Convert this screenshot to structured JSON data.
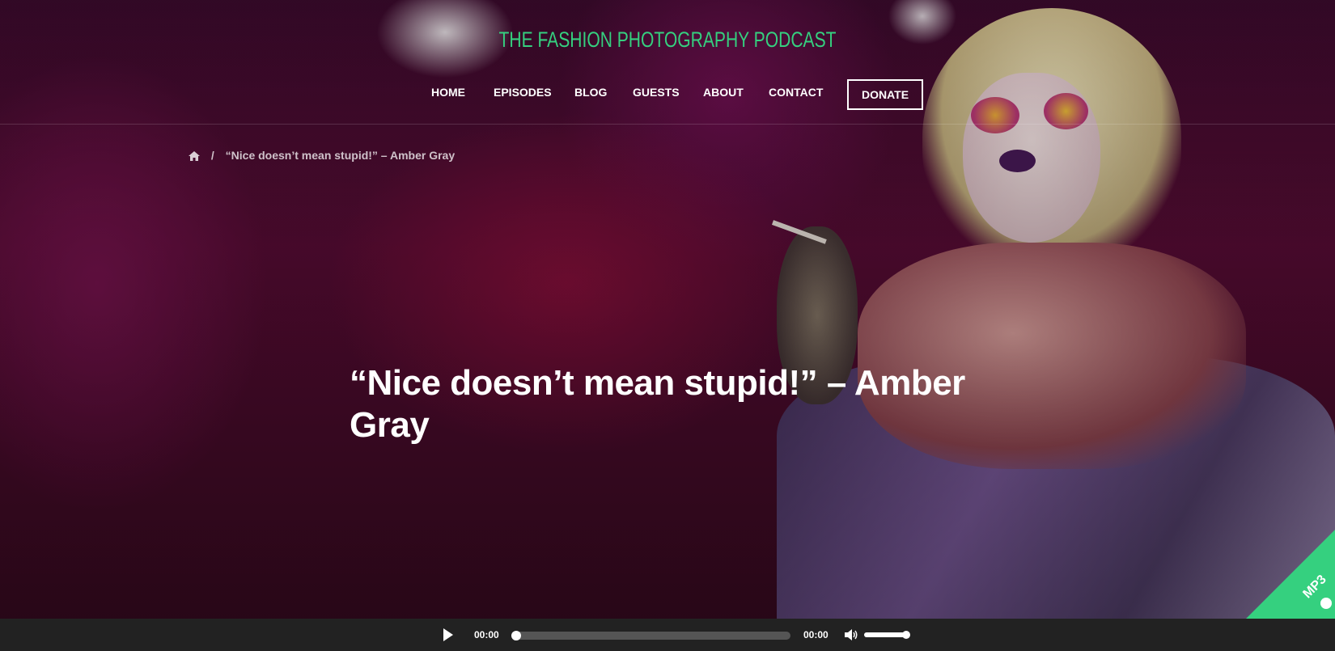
{
  "site": {
    "title": "THE FASHION PHOTOGRAPHY PODCAST",
    "accent_color": "#35d07f"
  },
  "nav": {
    "items": [
      {
        "label": "HOME"
      },
      {
        "label": "EPISODES"
      },
      {
        "label": "BLOG"
      },
      {
        "label": "GUESTS"
      },
      {
        "label": "ABOUT"
      },
      {
        "label": "CONTACT"
      }
    ],
    "donate_label": "DONATE"
  },
  "breadcrumb": {
    "home_icon": "home-icon",
    "separator": "/",
    "current": "“Nice doesn’t mean stupid!” – Amber Gray"
  },
  "post": {
    "title": "“Nice doesn’t mean stupid!” – Amber Gray"
  },
  "ribbon": {
    "label": "MP3",
    "icon": "download-icon"
  },
  "player": {
    "current_time": "00:00",
    "duration": "00:00",
    "progress": 0,
    "volume": 1.0
  }
}
